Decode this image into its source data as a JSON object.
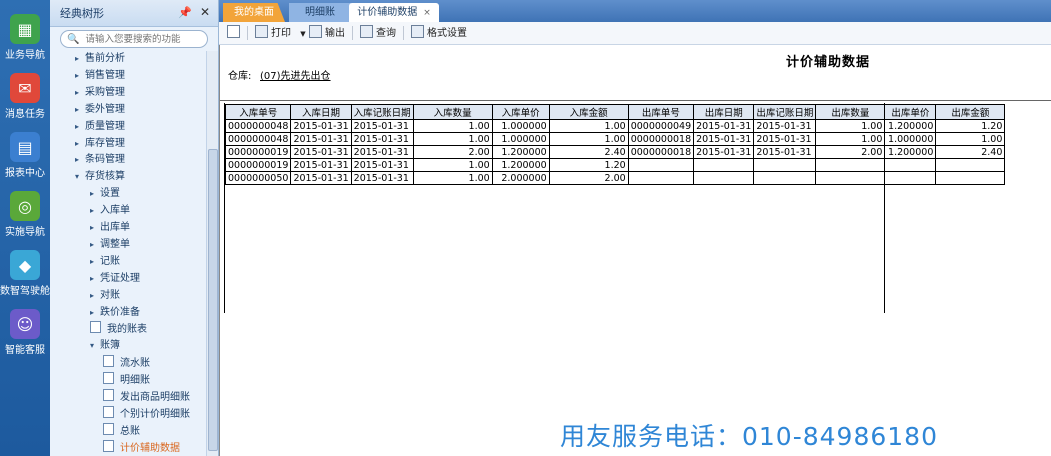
{
  "appbar": {
    "items": [
      {
        "label": "业务导航",
        "icon": "grid-nav-icon",
        "color": "#3fa34d"
      },
      {
        "label": "消息任务",
        "icon": "message-icon",
        "color": "#e0483a"
      },
      {
        "label": "报表中心",
        "icon": "report-icon",
        "color": "#3b7fd0"
      },
      {
        "label": "实施导航",
        "icon": "compass-icon",
        "color": "#5aa83a"
      },
      {
        "label": "数智驾驶舱",
        "icon": "cube-icon",
        "color": "#3aa7d6"
      },
      {
        "label": "智能客服",
        "icon": "robot-icon",
        "color": "#6c5bc9"
      }
    ]
  },
  "tree": {
    "title": "经典树形",
    "search_placeholder": "请输入您要搜索的功能",
    "nodes": [
      {
        "label": "售前分析",
        "level": 1,
        "type": "folder-collapsed"
      },
      {
        "label": "销售管理",
        "level": 1,
        "type": "folder-collapsed"
      },
      {
        "label": "采购管理",
        "level": 1,
        "type": "folder-collapsed"
      },
      {
        "label": "委外管理",
        "level": 1,
        "type": "folder-collapsed"
      },
      {
        "label": "质量管理",
        "level": 1,
        "type": "folder-collapsed"
      },
      {
        "label": "库存管理",
        "level": 1,
        "type": "folder-collapsed"
      },
      {
        "label": "条码管理",
        "level": 1,
        "type": "folder-collapsed"
      },
      {
        "label": "存货核算",
        "level": 1,
        "type": "folder-expanded"
      },
      {
        "label": "设置",
        "level": 2,
        "type": "folder-collapsed"
      },
      {
        "label": "入库单",
        "level": 2,
        "type": "folder-collapsed"
      },
      {
        "label": "出库单",
        "level": 2,
        "type": "folder-collapsed"
      },
      {
        "label": "调整单",
        "level": 2,
        "type": "folder-collapsed"
      },
      {
        "label": "记账",
        "level": 2,
        "type": "folder-collapsed"
      },
      {
        "label": "凭证处理",
        "level": 2,
        "type": "folder-collapsed"
      },
      {
        "label": "对账",
        "level": 2,
        "type": "folder-collapsed"
      },
      {
        "label": "跌价准备",
        "level": 2,
        "type": "folder-collapsed"
      },
      {
        "label": "我的账表",
        "level": 2,
        "type": "doc"
      },
      {
        "label": "账簿",
        "level": 2,
        "type": "folder-expanded"
      },
      {
        "label": "流水账",
        "level": 3,
        "type": "doc"
      },
      {
        "label": "明细账",
        "level": 3,
        "type": "doc"
      },
      {
        "label": "发出商品明细账",
        "level": 3,
        "type": "doc"
      },
      {
        "label": "个别计价明细账",
        "level": 3,
        "type": "doc"
      },
      {
        "label": "总账",
        "level": 3,
        "type": "doc"
      },
      {
        "label": "计价辅助数据",
        "level": 3,
        "type": "doc",
        "active": true
      }
    ]
  },
  "tabs": [
    {
      "label": "我的桌面"
    },
    {
      "label": "明细账"
    },
    {
      "label": "计价辅助数据",
      "close": "×"
    }
  ],
  "toolbar": {
    "print": "打印",
    "export": "输出",
    "query": "查询",
    "format": "格式设置"
  },
  "report": {
    "title": "计价辅助数据",
    "warehouse_label": "仓库:",
    "warehouse_value": "(07)先进先出仓",
    "columns": [
      "入库单号",
      "入库日期",
      "入库记账日期",
      "入库数量",
      "入库单价",
      "入库金额",
      "出库单号",
      "出库日期",
      "出库记账日期",
      "出库数量",
      "出库单价",
      "出库金额"
    ],
    "rows": [
      [
        "0000000048",
        "2015-01-31",
        "2015-01-31",
        "1.00",
        "1.000000",
        "1.00",
        "0000000049",
        "2015-01-31",
        "2015-01-31",
        "1.00",
        "1.200000",
        "1.20"
      ],
      [
        "0000000048",
        "2015-01-31",
        "2015-01-31",
        "1.00",
        "1.000000",
        "1.00",
        "0000000018",
        "2015-01-31",
        "2015-01-31",
        "1.00",
        "1.000000",
        "1.00"
      ],
      [
        "0000000019",
        "2015-01-31",
        "2015-01-31",
        "2.00",
        "1.200000",
        "2.40",
        "0000000018",
        "2015-01-31",
        "2015-01-31",
        "2.00",
        "1.200000",
        "2.40"
      ],
      [
        "0000000019",
        "2015-01-31",
        "2015-01-31",
        "1.00",
        "1.200000",
        "1.20",
        "",
        "",
        "",
        "",
        "",
        ""
      ],
      [
        "0000000050",
        "2015-01-31",
        "2015-01-31",
        "1.00",
        "2.000000",
        "2.00",
        "",
        "",
        "",
        "",
        "",
        ""
      ]
    ]
  },
  "watermark": {
    "text": "用友服务电话：010-84986180",
    "color": "#2f86d6"
  }
}
